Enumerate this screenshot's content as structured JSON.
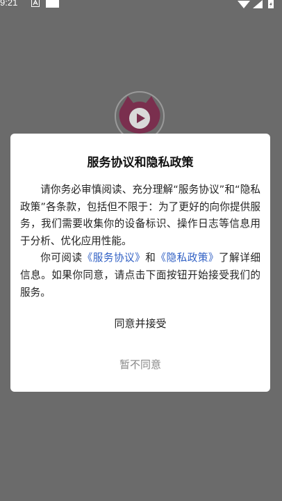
{
  "status_bar": {
    "time": "9:21",
    "notification_icon": "a-letter-icon",
    "left_box_icon": "square-icon",
    "right_icons": [
      "wifi-icon",
      "signal-icon",
      "battery-icon"
    ]
  },
  "splash": {
    "logo_icon": "cat-play-logo-icon",
    "logo_color": "#c2185b"
  },
  "dialog": {
    "title": "服务协议和隐私政策",
    "paragraph1": "请你务必审慎阅读、充分理解“服务协议”和“隐私政策”各条款，包括但不限于：为了更好的向你提供服务，我们需要收集你的设备标识、操作日志等信息用于分析、优化应用性能。",
    "paragraph2_prefix": "你可阅读",
    "service_link": "《服务协议》",
    "and_text": "和",
    "privacy_link": "《隐私政策》",
    "paragraph2_suffix": "了解详细信息。如果你同意，请点击下面按钮开始接受我们的服务。",
    "agree_label": "同意并接受",
    "decline_label": "暂不同意",
    "link_color": "#2f5fc4"
  }
}
